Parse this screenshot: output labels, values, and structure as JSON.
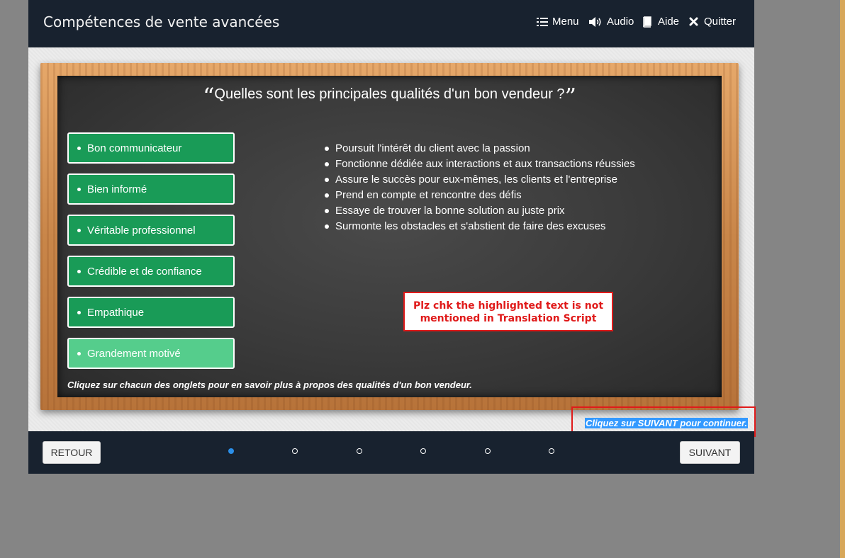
{
  "header": {
    "title": "Compétences de vente avancées",
    "menu_label": "Menu",
    "audio_label": "Audio",
    "help_label": "Aide",
    "quit_label": "Quitter"
  },
  "board": {
    "title": "Quelles sont les principales qualités d'un bon vendeur ?",
    "quote_open": "“",
    "quote_close": "”",
    "tabs": [
      {
        "label": "Bon communicateur",
        "active": false
      },
      {
        "label": "Bien informé",
        "active": false
      },
      {
        "label": "Véritable professionnel",
        "active": false
      },
      {
        "label": "Crédible et de confiance",
        "active": false
      },
      {
        "label": "Empathique",
        "active": false
      },
      {
        "label": "Grandement motivé",
        "active": true
      }
    ],
    "details": [
      "Poursuit l'intérêt du client avec la passion",
      "Fonctionne dédiée aux interactions et aux transactions réussies",
      "Assure le succès pour eux-mêmes, les clients et l'entreprise",
      "Prend en compte et rencontre des défis",
      "Essaye de trouver la bonne solution au juste prix",
      "Surmonte les obstacles et s'abstient de faire des excuses"
    ],
    "instruction": "Cliquez sur chacun des onglets pour en savoir plus à propos des qualités d'un bon vendeur."
  },
  "review_note": {
    "line1": "Plz chk the highlighted text is not",
    "line2": "mentioned in Translation Script"
  },
  "continue_text": "Cliquez sur SUIVANT pour continuer.",
  "footer": {
    "back_label": "RETOUR",
    "next_label": "SUIVANT",
    "pages": 6,
    "current_page": 1
  },
  "colors": {
    "header_bg": "#18222f",
    "tab_green": "#199b57",
    "tab_active": "#55cd8c",
    "note_red": "#e01a1a",
    "highlight": "#3399ff",
    "page_dot_active": "#2b8fe8"
  }
}
